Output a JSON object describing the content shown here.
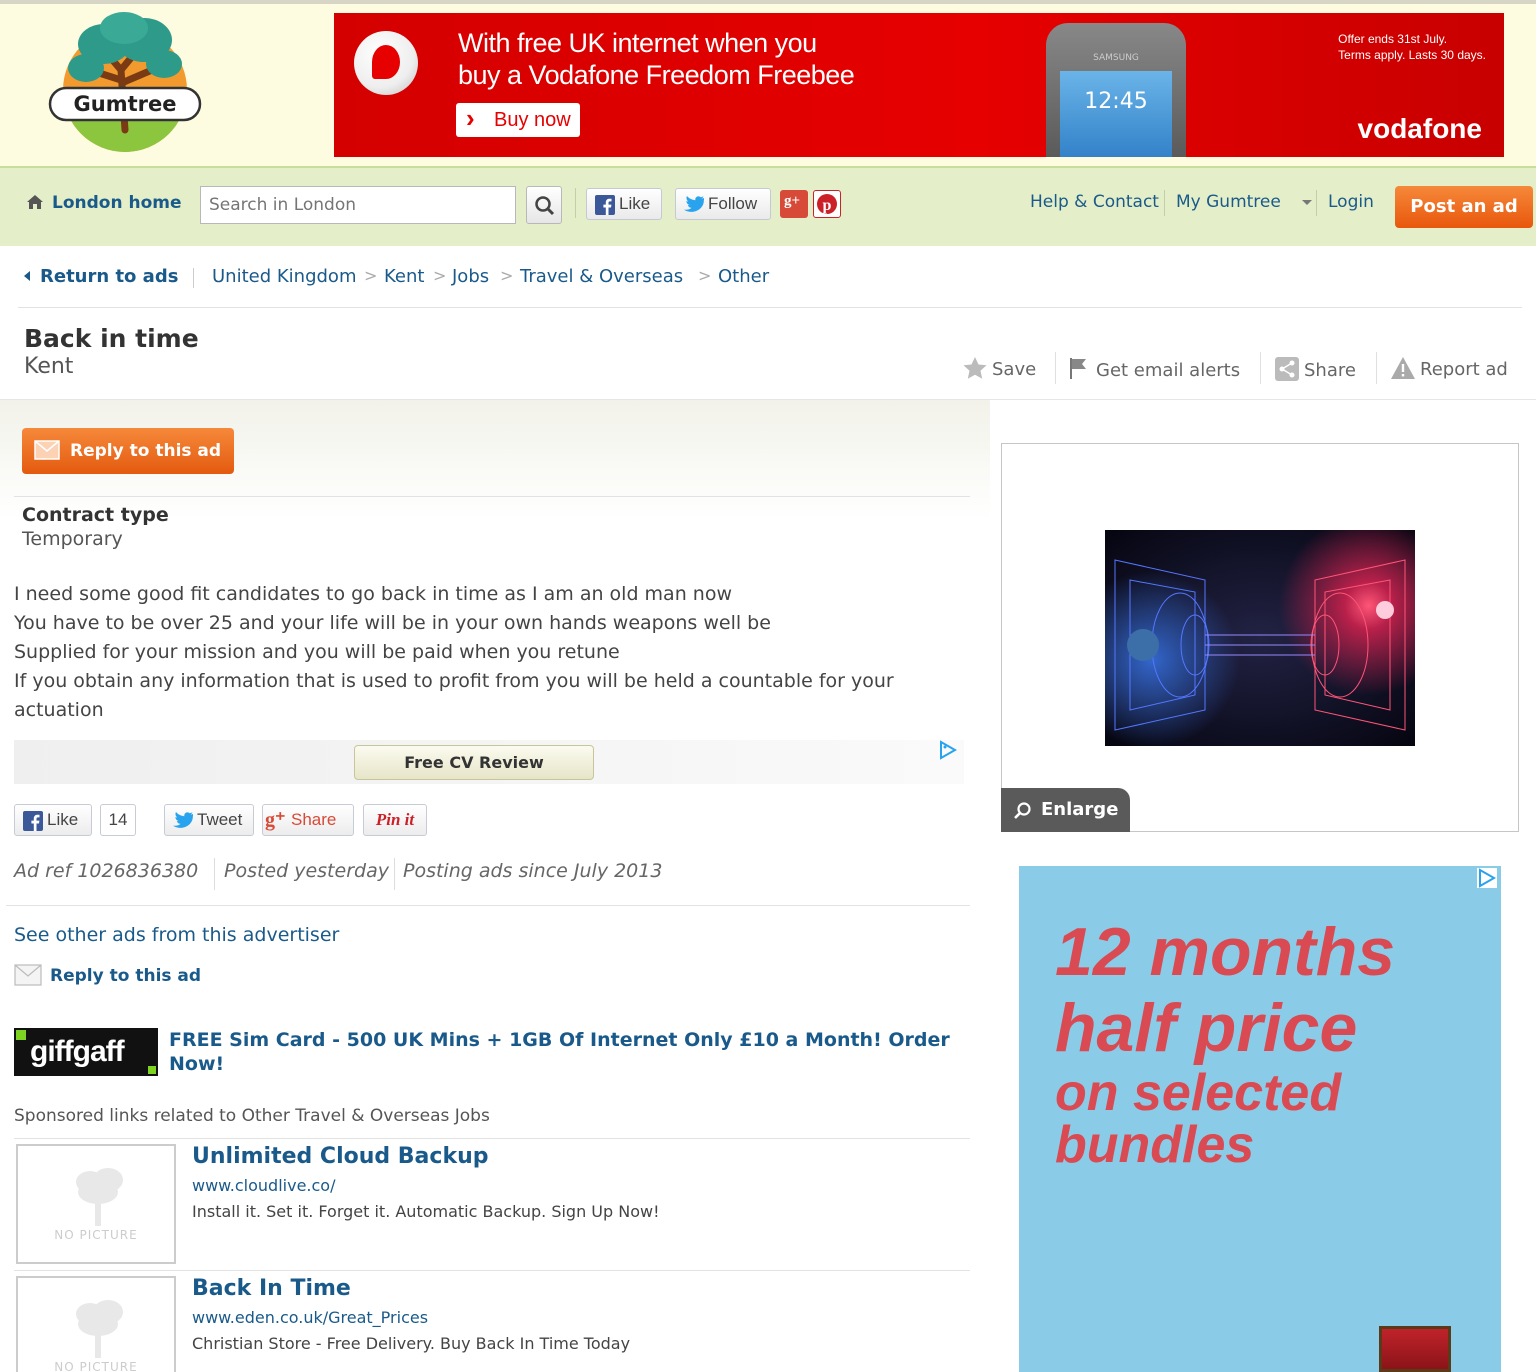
{
  "header": {
    "logo_text": "Gumtree",
    "banner": {
      "line1": "With free UK internet when you",
      "line2": "buy a Vodafone Freedom Freebee",
      "cta": "Buy now",
      "offer_line1": "Offer ends 31st July.",
      "offer_line2": "Terms apply. Lasts 30 days.",
      "brand": "vodafone",
      "phone_time": "12:45",
      "phone_brand": "SAMSUNG"
    }
  },
  "nav": {
    "home_label": "London home",
    "search_placeholder": "Search in London",
    "like_label": "Like",
    "follow_label": "Follow",
    "help_label": "Help & Contact",
    "my_gumtree_label": "My Gumtree",
    "login_label": "Login",
    "post_ad_label": "Post an ad"
  },
  "breadcrumb": {
    "return_label": "Return to ads",
    "items": [
      "United Kingdom",
      "Kent",
      "Jobs",
      "Travel & Overseas",
      "Other"
    ]
  },
  "ad": {
    "title": "Back in time",
    "location": "Kent",
    "actions": {
      "save": "Save",
      "alerts": "Get email alerts",
      "share": "Share",
      "report": "Report ad"
    },
    "reply_label": "Reply to this ad",
    "contract_label": "Contract type",
    "contract_value": "Temporary",
    "description": [
      "I need some good fit candidates to go back in time as I am an old man now",
      "You have to be over 25 and your life will be in your own hands weapons well be",
      "Supplied for your mission and you will be paid when you retune",
      "If you obtain any information that is used to profit from you will be held a countable for your actuation"
    ],
    "adsense_button": "Free CV Review",
    "share_bar": {
      "like": "Like",
      "like_count": "14",
      "tweet": "Tweet",
      "gplus": "Share",
      "pinit": "Pin it"
    },
    "meta": {
      "ref": "Ad ref 1026836380",
      "posted": "Posted yesterday",
      "since": "Posting ads since July 2013"
    },
    "other_ads_label": "See other ads from this advertiser",
    "reply_small_label": "Reply to this ad",
    "enlarge_label": "Enlarge"
  },
  "giffgaff": {
    "logo": "giffgaff",
    "text": "FREE Sim Card - 500 UK Mins + 1GB Of Internet Only £10 a Month! Order Now!"
  },
  "sponsored": {
    "heading": "Sponsored links related to Other Travel & Overseas Jobs",
    "no_picture": "NO PICTURE",
    "items": [
      {
        "title": "Unlimited Cloud Backup",
        "url": "www.cloudlive.co/",
        "desc": "Install it. Set it. Forget it. Automatic Backup. Sign Up Now!"
      },
      {
        "title": "Back In Time",
        "url": "www.eden.co.uk/Great_Prices",
        "desc": "Christian Store - Free Delivery. Buy Back In Time Today"
      }
    ]
  },
  "promo": {
    "line1": "12 months",
    "line2": "half price",
    "line3": "on selected",
    "line4": "bundles"
  },
  "colors": {
    "link": "#1a5a8a",
    "orange": "#e8570c",
    "header_bg": "#fdfbe0",
    "nav_bg": "#e4efc9",
    "vodafone_red": "#e60000",
    "promo_bg": "#8acce8",
    "promo_text": "#d94a52"
  }
}
